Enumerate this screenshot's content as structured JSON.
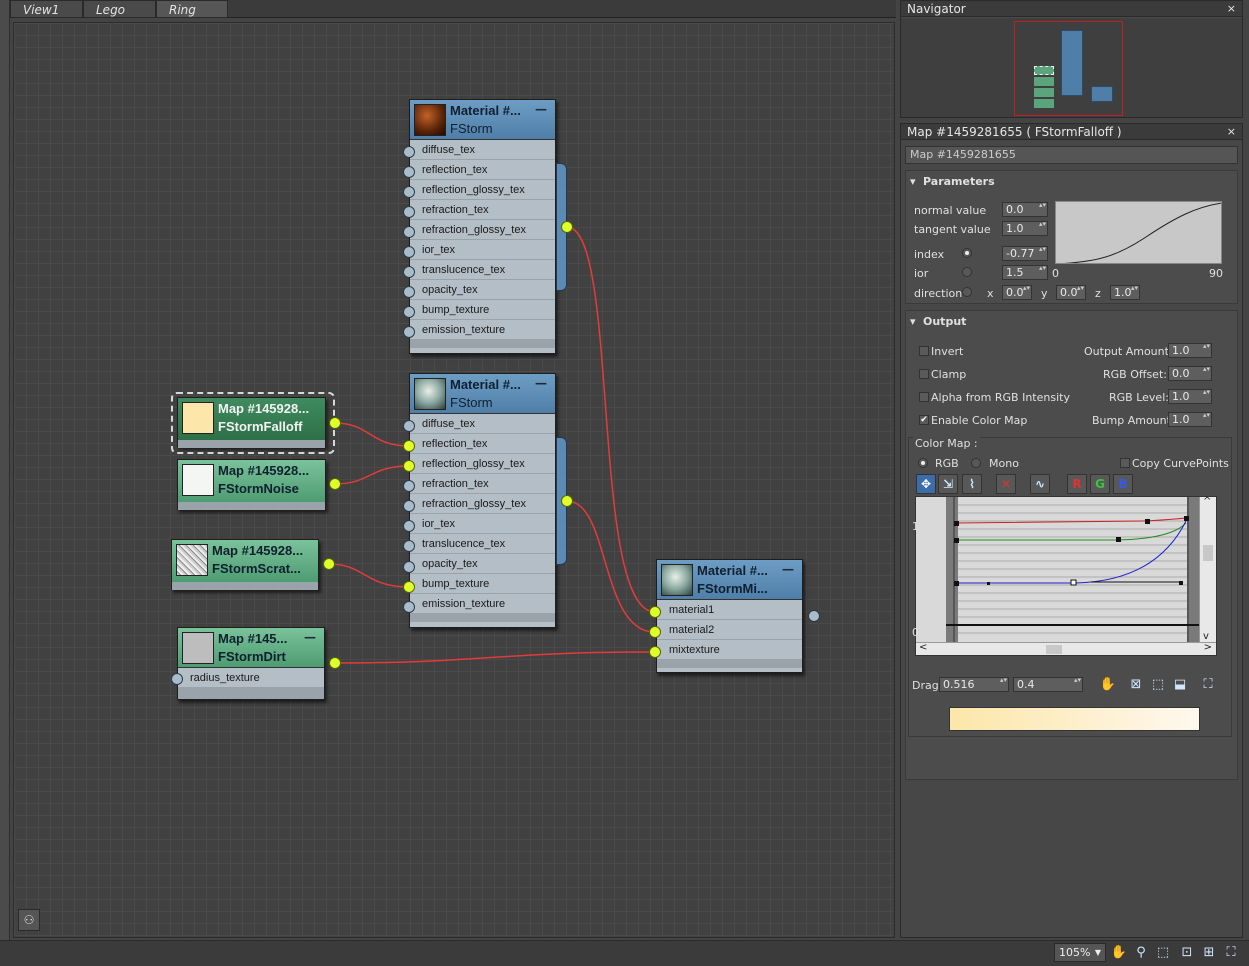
{
  "tabs": [
    {
      "label": "View1"
    },
    {
      "label": "Lego"
    },
    {
      "label": "Ring"
    }
  ],
  "colors": {
    "wire": "#e23b3b",
    "socket_active": "#dfff2a",
    "material_header": "#5f8fb9",
    "map_header": "#63ae84",
    "gradient_start": "#fce6a9",
    "gradient_end": "#fff8ee"
  },
  "nodes": {
    "mat1": {
      "title": "Material #...",
      "type": "FStorm",
      "swatch": "sphere-brown",
      "slots": [
        "diffuse_tex",
        "reflection_tex",
        "reflection_glossy_tex",
        "refraction_tex",
        "refraction_glossy_tex",
        "ior_tex",
        "translucence_tex",
        "opacity_tex",
        "bump_texture",
        "emission_texture"
      ]
    },
    "mat2": {
      "title": "Material #...",
      "type": "FStorm",
      "swatch": "sphere-glass",
      "slots": [
        "diffuse_tex",
        "reflection_tex",
        "reflection_glossy_tex",
        "refraction_tex",
        "refraction_glossy_tex",
        "ior_tex",
        "translucence_tex",
        "opacity_tex",
        "bump_texture",
        "emission_texture"
      ]
    },
    "falloff": {
      "title": "Map #145928...",
      "type": "FStormFalloff"
    },
    "noise": {
      "title": "Map #145928...",
      "type": "FStormNoise"
    },
    "scratch": {
      "title": "Map #145928...",
      "type": "FStormScrat..."
    },
    "dirt": {
      "title": "Map #145...",
      "type": "FStormDirt",
      "slots": [
        "radius_texture"
      ]
    },
    "mix": {
      "title": "Material #...",
      "type": "FStormMi...",
      "slots": [
        "material1",
        "material2",
        "mixtexture"
      ]
    }
  },
  "navigator": {
    "title": "Navigator"
  },
  "editor": {
    "title": "Map #1459281655  ( FStormFalloff )",
    "name_value": "Map #1459281655",
    "parameters": {
      "header": "Parameters",
      "normal_label": "normal value",
      "normal_value": "0.0",
      "tangent_label": "tangent value",
      "tangent_value": "1.0",
      "index_label": "index",
      "index_value": "-0.77",
      "ior_label": "ior",
      "ior_value": "1.5",
      "direction_label": "direction",
      "x_label": "x",
      "x_value": "0.0",
      "y_label": "y",
      "y_value": "0.0",
      "z_label": "z",
      "z_value": "1.0",
      "curve_min": "0",
      "curve_max": "90"
    },
    "output": {
      "header": "Output",
      "invert": "Invert",
      "clamp": "Clamp",
      "alpha": "Alpha from RGB Intensity",
      "enable": "Enable Color Map",
      "output_amount_label": "Output Amount:",
      "output_amount": "1.0",
      "rgb_offset_label": "RGB Offset:",
      "rgb_offset": "0.0",
      "rgb_level_label": "RGB Level:",
      "rgb_level": "1.0",
      "bump_amount_label": "Bump Amount:",
      "bump_amount": "1.0",
      "colormap_label": "Color Map :",
      "rgb": "RGB",
      "mono": "Mono",
      "copy": "Copy CurvePoints",
      "btn_r": "R",
      "btn_g": "G",
      "btn_b": "B",
      "axis_1": "1",
      "axis_0": "0",
      "drag_label": "Drag",
      "drag_x": "0.516",
      "drag_y": "0.4"
    }
  },
  "statusbar": {
    "zoom": "105%"
  }
}
